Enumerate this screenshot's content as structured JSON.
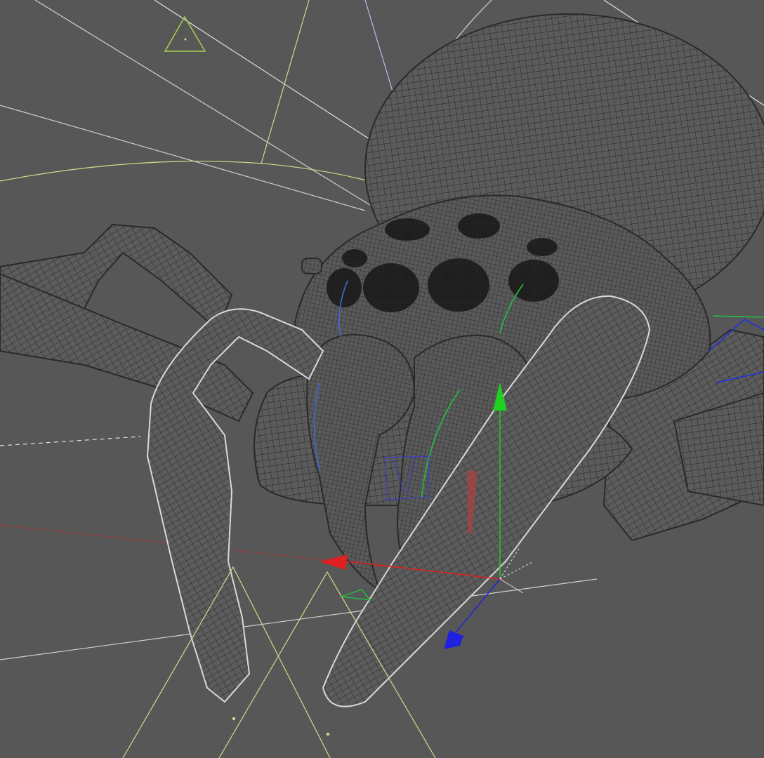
{
  "viewport": {
    "background": "#575757",
    "mode": "wireframe",
    "object": "spider-model"
  },
  "colors": {
    "mesh_fill": "#5a5a5a",
    "mesh_grid": "#2a2a2a",
    "mesh_outline": "#d8d8d8",
    "eye": "#1e1e1e",
    "camera_line": "#d8d88a",
    "camera_icon": "#a6d24a",
    "axis_x": "#e02020",
    "axis_y": "#20d020",
    "axis_z": "#2020e0",
    "light_line": "#c8cce0"
  },
  "gizmo": {
    "type": "move-manipulator",
    "axes": [
      "x-axis",
      "y-axis",
      "z-axis"
    ]
  }
}
